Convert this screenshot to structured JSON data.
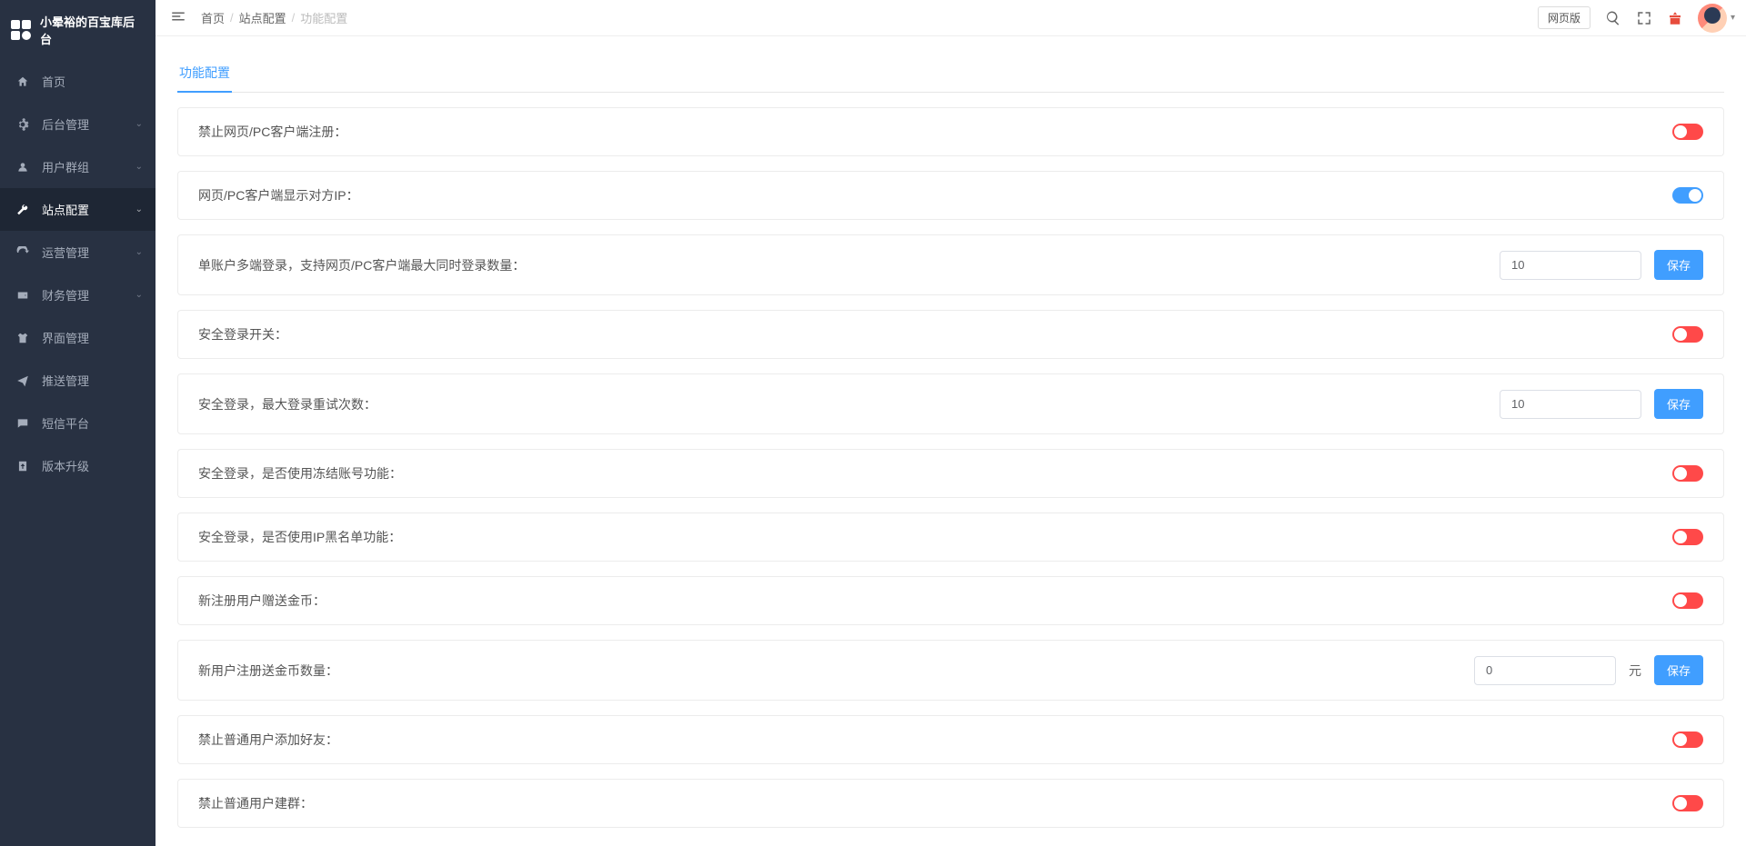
{
  "brand": "小晕裕的百宝库后台",
  "sidebar": {
    "items": [
      {
        "label": "首页",
        "icon": "home",
        "expand": false
      },
      {
        "label": "后台管理",
        "icon": "gear",
        "expand": true
      },
      {
        "label": "用户群组",
        "icon": "user",
        "expand": true
      },
      {
        "label": "站点配置",
        "icon": "wrench",
        "expand": true,
        "active": true
      },
      {
        "label": "运营管理",
        "icon": "refresh",
        "expand": true
      },
      {
        "label": "财务管理",
        "icon": "wallet",
        "expand": true
      },
      {
        "label": "界面管理",
        "icon": "shirt",
        "expand": false
      },
      {
        "label": "推送管理",
        "icon": "send",
        "expand": false
      },
      {
        "label": "短信平台",
        "icon": "chat",
        "expand": false
      },
      {
        "label": "版本升级",
        "icon": "up",
        "expand": false
      }
    ]
  },
  "breadcrumb": {
    "home": "首页",
    "l1": "站点配置",
    "l2": "功能配置",
    "sep": "/"
  },
  "topbar": {
    "web_button": "网页版"
  },
  "tab_title": "功能配置",
  "save_label": "保存",
  "suffix_yuan": "元",
  "rows": [
    {
      "label": "禁止网页/PC客户端注册：",
      "type": "toggle",
      "value": false
    },
    {
      "label": "网页/PC客户端显示对方IP：",
      "type": "toggle",
      "value": true
    },
    {
      "label": "单账户多端登录，支持网页/PC客户端最大同时登录数量：",
      "type": "input",
      "value": "10"
    },
    {
      "label": "安全登录开关：",
      "type": "toggle",
      "value": false
    },
    {
      "label": "安全登录，最大登录重试次数：",
      "type": "input",
      "value": "10"
    },
    {
      "label": "安全登录，是否使用冻结账号功能：",
      "type": "toggle",
      "value": false
    },
    {
      "label": "安全登录，是否使用IP黑名单功能：",
      "type": "toggle",
      "value": false
    },
    {
      "label": "新注册用户赠送金币：",
      "type": "toggle",
      "value": false
    },
    {
      "label": "新用户注册送金币数量：",
      "type": "input",
      "value": "0",
      "suffix": true
    },
    {
      "label": "禁止普通用户添加好友：",
      "type": "toggle",
      "value": false
    },
    {
      "label": "禁止普通用户建群：",
      "type": "toggle",
      "value": false
    }
  ]
}
